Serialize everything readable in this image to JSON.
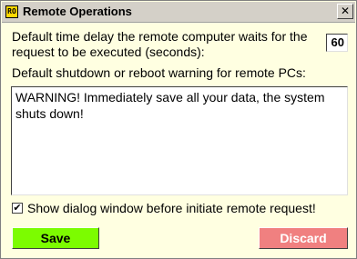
{
  "window": {
    "title": "Remote Operations",
    "icon_glyph": "RO",
    "close_glyph": "✕"
  },
  "delay": {
    "label": "Default time delay the remote computer waits for the request to be executed (seconds):",
    "value": "60"
  },
  "warning": {
    "label": "Default shutdown or reboot warning for remote PCs:",
    "text": "WARNING! Immediately save all your data, the system shuts down!"
  },
  "dialog_option": {
    "checked": true,
    "check_glyph": "✔",
    "label": "Show dialog window before initiate remote request!"
  },
  "buttons": {
    "save_label": "Save",
    "discard_label": "Discard"
  },
  "colors": {
    "background": "#ffffe1",
    "save_button": "#7cfc00",
    "discard_button": "#f08080"
  }
}
